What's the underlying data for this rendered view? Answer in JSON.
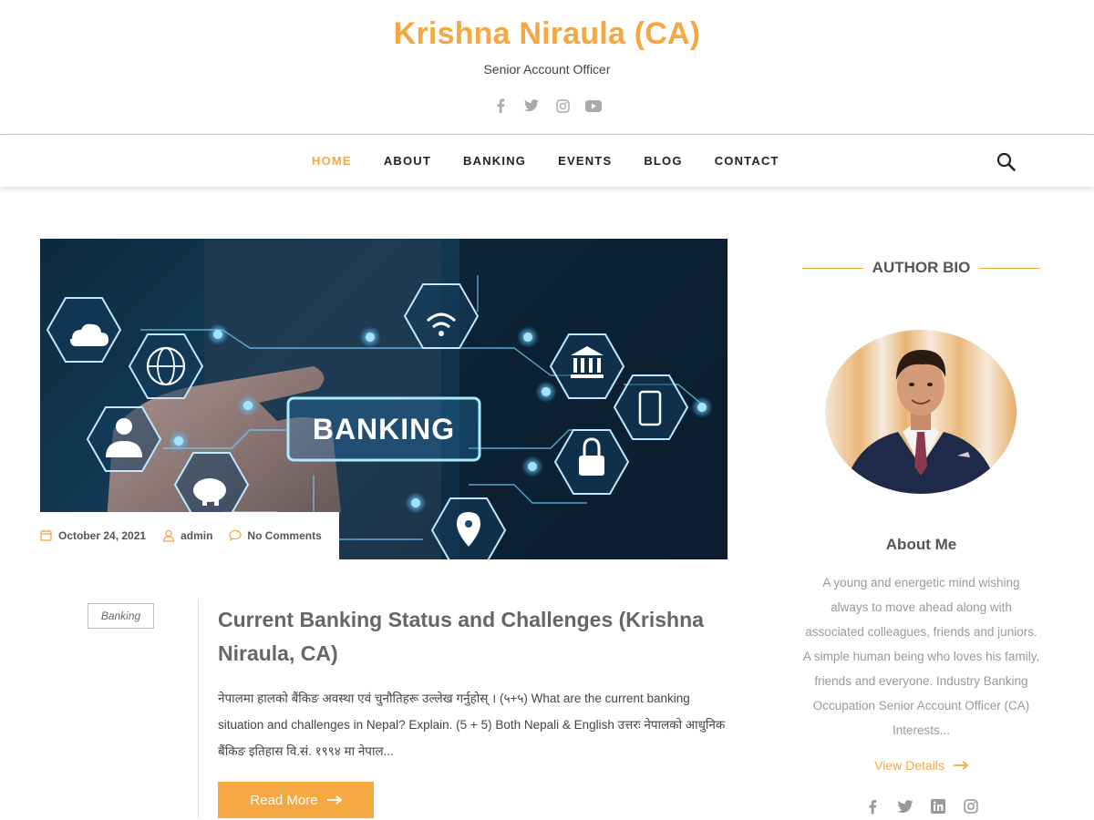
{
  "header": {
    "site_title": "Krishna Niraula (CA)",
    "tagline": "Senior Account Officer",
    "social": [
      "facebook-icon",
      "twitter-icon",
      "instagram-icon",
      "youtube-icon"
    ]
  },
  "nav": {
    "items": [
      {
        "label": "HOME",
        "active": true
      },
      {
        "label": "ABOUT",
        "active": false
      },
      {
        "label": "BANKING",
        "active": false
      },
      {
        "label": "EVENTS",
        "active": false
      },
      {
        "label": "BLOG",
        "active": false
      },
      {
        "label": "CONTACT",
        "active": false
      }
    ],
    "search_icon": "search-icon"
  },
  "post": {
    "image_text": "BANKING",
    "date": "October 24, 2021",
    "author": "admin",
    "comments": "No Comments",
    "category": "Banking",
    "title": "Current Banking Status and Challenges (Krishna Niraula, CA)",
    "excerpt": "नेपालमा हालको बैंकिङ अवस्था एवं चुनौतिहरू उल्लेख गर्नुहोस् । (५+५) What are the current banking situation and challenges in Nepal? Explain. (5 + 5) Both Nepali & English उत्तरः नेपालको आधुनिक बैंकिङ इतिहास वि.सं. १९९४ मा नेपाल...",
    "read_more": "Read More"
  },
  "sidebar": {
    "widget_title": "AUTHOR BIO",
    "about_title": "About Me",
    "about_text": "A young and energetic mind wishing always to move ahead along with associated colleagues, friends and juniors. A simple human being who loves his family, friends and everyone. Industry Banking Occupation Senior Account Officer (CA) Interests...",
    "view_details": "View Details",
    "social": [
      "facebook-icon",
      "twitter-icon",
      "linkedin-icon",
      "instagram-icon"
    ]
  },
  "colors": {
    "accent": "#f5a742",
    "text_dark": "#222222",
    "text_muted": "#999999"
  }
}
